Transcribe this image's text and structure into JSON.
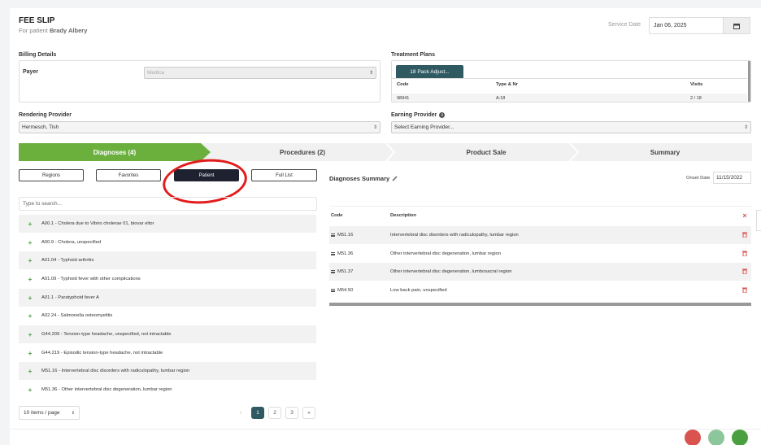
{
  "header": {
    "title": "FEE SLIP",
    "subtitle_prefix": "For patient",
    "patient_name": "Brady Albery",
    "service_date_label": "Service Date",
    "service_date": "Jan 06, 2025"
  },
  "billing": {
    "section_label": "Billing Details",
    "payer_label": "Payer",
    "payer_value": "Medica"
  },
  "treatment": {
    "section_label": "Treatment Plans",
    "plan_tab": "18 Pack Adjust...",
    "columns": [
      "Code",
      "Type & Nr",
      "Visits"
    ],
    "rows": [
      [
        "98941",
        "A:18",
        "2 / 18"
      ]
    ]
  },
  "rendering": {
    "label": "Rendering Provider",
    "value": "Hermesch, Tish"
  },
  "earning": {
    "label": "Earning Provider",
    "placeholder": "Select Earning Provider..."
  },
  "tabs": [
    {
      "label": "Diagnoses (4)"
    },
    {
      "label": "Procedures (2)"
    },
    {
      "label": "Product Sale"
    },
    {
      "label": "Summary"
    }
  ],
  "filters": [
    "Regions",
    "Favorites",
    "Patient",
    "Full List"
  ],
  "search_placeholder": "Type to search...",
  "diagnoses_list": [
    "A00.1 - Cholera due to Vibrio cholerae 01, biovar eltor",
    "A00.9 - Cholera, unspecified",
    "A01.04 - Typhoid arthritis",
    "A01.09 - Typhoid fever with other complications",
    "A01.1 - Paratyphoid fever A",
    "A02.24 - Salmonella osteomyelitis",
    "G44.209 - Tension-type headache, unspecified, not intractable",
    "G44.219 - Episodic tension-type headache, not intractable",
    "M51.16 - Intervertebral disc disorders with radiculopathy, lumbar region",
    "M51.36 - Other intervertebral disc degeneration, lumbar region"
  ],
  "pagination": {
    "per_page": "10 items / page",
    "prev": "‹",
    "pages": [
      "1",
      "2",
      "3"
    ],
    "next": "»"
  },
  "summary": {
    "title": "Diagnoses Summary",
    "onset_label": "Onset Date",
    "onset_value": "11/15/2022",
    "col_code": "Code",
    "col_desc": "Description",
    "rows": [
      {
        "code": "M51.16",
        "desc": "Intervertebral disc disorders with radiculopathy, lumbar region"
      },
      {
        "code": "M51.36",
        "desc": "Other intervertebral disc degeneration, lumbar region"
      },
      {
        "code": "M51.37",
        "desc": "Other intervertebral disc degeneration, lumbosacral region"
      },
      {
        "code": "M54.50",
        "desc": "Low back pain, unspecified"
      }
    ]
  },
  "colors": {
    "active_tab": "#6bb03d",
    "patient_button": "#1e2230",
    "pager_active": "#2f5a62",
    "annotation": "#e21c1c",
    "delete": "#d9534f"
  }
}
